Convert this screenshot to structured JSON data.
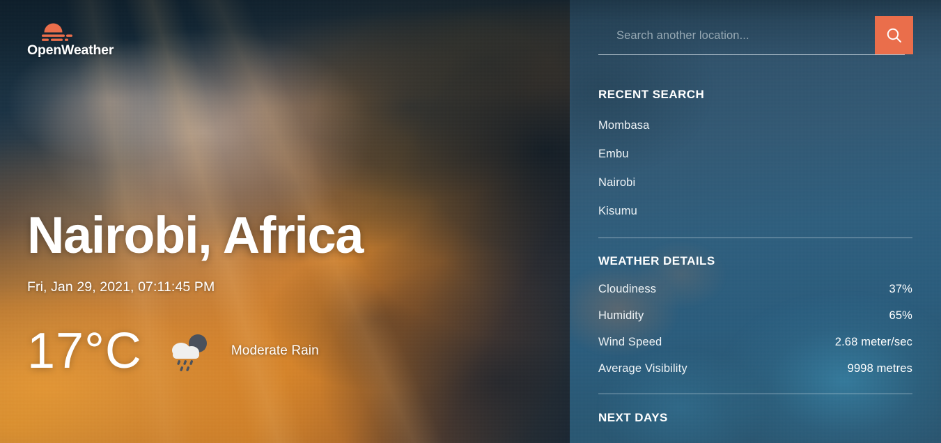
{
  "brand": {
    "name": "OpenWeather",
    "logo_icon": "sun-horizon-icon",
    "accent_color": "#ea6e4b"
  },
  "hero": {
    "city": "Nairobi, Africa",
    "datetime": "Fri, Jan 29, 2021, 07:11:45 PM",
    "temperature": "17°C",
    "condition": "Moderate Rain",
    "condition_icon": "rain-cloud-icon"
  },
  "search": {
    "placeholder": "Search another location...",
    "value": "",
    "button_icon": "search-icon"
  },
  "recent": {
    "title": "RECENT SEARCH",
    "items": [
      {
        "label": "Mombasa"
      },
      {
        "label": "Embu"
      },
      {
        "label": "Nairobi"
      },
      {
        "label": "Kisumu"
      }
    ]
  },
  "details": {
    "title": "WEATHER DETAILS",
    "rows": [
      {
        "label": "Cloudiness",
        "value": "37%"
      },
      {
        "label": "Humidity",
        "value": "65%"
      },
      {
        "label": "Wind Speed",
        "value": "2.68 meter/sec"
      },
      {
        "label": "Average Visibility",
        "value": "9998 metres"
      }
    ]
  },
  "next_days": {
    "title": "NEXT DAYS"
  }
}
